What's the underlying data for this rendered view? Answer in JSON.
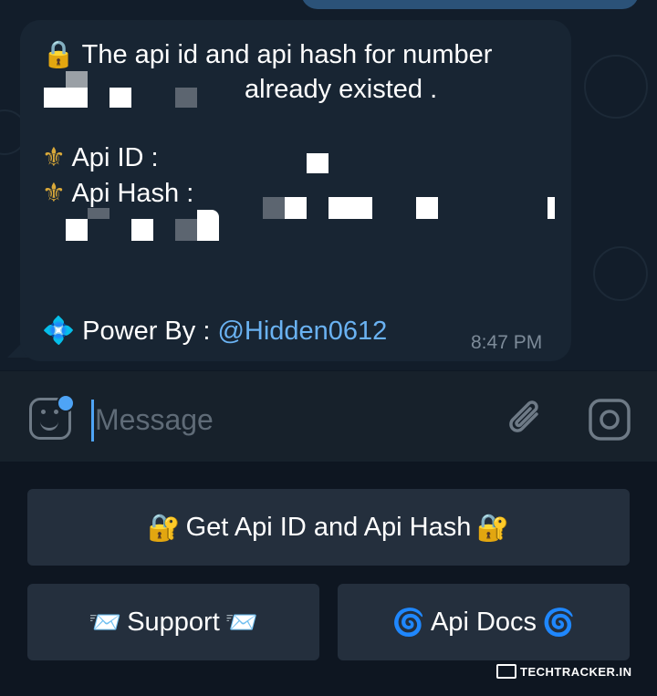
{
  "message": {
    "line1": "The api id and api hash for number",
    "line2": "already existed .",
    "api_id_label": "Api ID :",
    "api_hash_label": "Api Hash :",
    "power_by_label": "Power By :",
    "mention": "@Hidden0612",
    "time": "8:47 PM",
    "lock_emoji": "🔒",
    "fleur_emoji": "⚜",
    "diamond_emoji": "💠"
  },
  "input": {
    "placeholder": "Message"
  },
  "keyboard": {
    "main_button": "Get Api ID and Api Hash",
    "main_emoji": "🔐",
    "support_button": "Support",
    "support_emoji": "📨",
    "docs_button": "Api Docs",
    "docs_emoji": "🌀"
  },
  "watermark": "TECHTRACKER.IN",
  "colors": {
    "background": "#0e1621",
    "bubble": "#182533",
    "accent": "#4ea4f6",
    "mention": "#6ab2f2",
    "keyboard_button": "#242f3d"
  }
}
